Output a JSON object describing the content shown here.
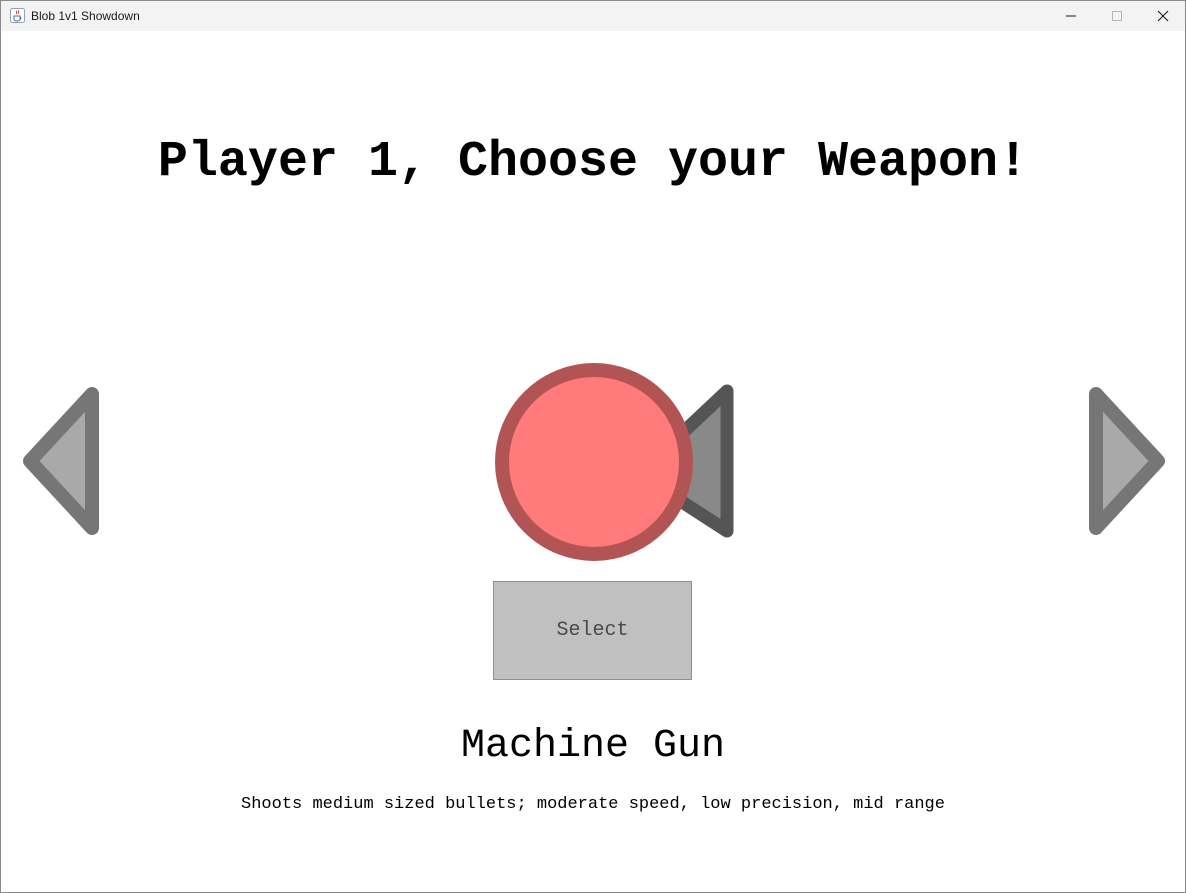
{
  "window": {
    "title": "Blob 1v1 Showdown",
    "icons": {
      "app": "java-coffee-cup-icon",
      "minimize": "minimize-icon",
      "maximize": "maximize-icon",
      "close": "close-icon"
    }
  },
  "screen": {
    "heading": "Player 1, Choose your Weapon!",
    "select_label": "Select",
    "weapon": {
      "name": "Machine Gun",
      "description": "Shoots medium sized bullets; moderate speed, low precision, mid range"
    },
    "icons": {
      "previous": "previous-arrow-icon",
      "next": "next-arrow-icon"
    }
  },
  "colors": {
    "blob_fill": "#ff7b7b",
    "blob_outline": "#b25454",
    "gun_fill": "#898989",
    "gun_outline": "#555555",
    "arrow_fill": "#a9a9a9",
    "arrow_outline": "#767676",
    "button_bg": "#c0c0c0"
  }
}
